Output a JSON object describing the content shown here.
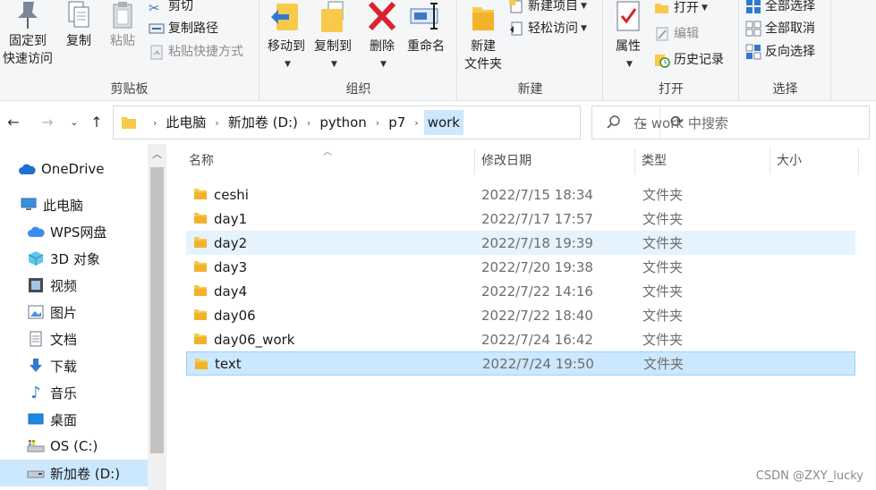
{
  "ribbon": {
    "clipboard": {
      "label": "剪贴板",
      "pin": "固定到\n快速访问",
      "pin_line1": "固定到",
      "pin_line2": "快速访问",
      "copy": "复制",
      "paste": "粘贴",
      "cut": "剪切",
      "copy_path": "复制路径",
      "paste_shortcut": "粘贴快捷方式"
    },
    "organize": {
      "label": "组织",
      "move_to": "移动到",
      "copy_to": "复制到",
      "delete": "删除",
      "rename": "重命名"
    },
    "new": {
      "label": "新建",
      "new_folder_line1": "新建",
      "new_folder_line2": "文件夹",
      "new_item": "新建项目",
      "easy_access": "轻松访问"
    },
    "open": {
      "label": "打开",
      "properties": "属性",
      "open": "打开",
      "edit": "编辑",
      "history": "历史记录"
    },
    "select": {
      "label": "选择",
      "select_all": "全部选择",
      "select_none": "全部取消",
      "invert": "反向选择"
    }
  },
  "address": {
    "crumbs": [
      "此电脑",
      "新加卷 (D:)",
      "python",
      "p7",
      "work"
    ],
    "search_placeholder": "在 work 中搜索"
  },
  "nav": {
    "items": [
      {
        "label": "OneDrive"
      },
      {
        "label": "此电脑"
      },
      {
        "label": "WPS网盘"
      },
      {
        "label": "3D 对象"
      },
      {
        "label": "视频"
      },
      {
        "label": "图片"
      },
      {
        "label": "文档"
      },
      {
        "label": "下载"
      },
      {
        "label": "音乐"
      },
      {
        "label": "桌面"
      },
      {
        "label": "OS (C:)"
      },
      {
        "label": "新加卷 (D:)"
      }
    ]
  },
  "list": {
    "columns": {
      "name": "名称",
      "date": "修改日期",
      "type": "类型",
      "size": "大小"
    },
    "rows": [
      {
        "name": "ceshi",
        "date": "2022/7/15 18:34",
        "type": "文件夹"
      },
      {
        "name": "day1",
        "date": "2022/7/17 17:57",
        "type": "文件夹"
      },
      {
        "name": "day2",
        "date": "2022/7/18 19:39",
        "type": "文件夹"
      },
      {
        "name": "day3",
        "date": "2022/7/20 19:38",
        "type": "文件夹"
      },
      {
        "name": "day4",
        "date": "2022/7/22 14:16",
        "type": "文件夹"
      },
      {
        "name": "day06",
        "date": "2022/7/22 18:40",
        "type": "文件夹"
      },
      {
        "name": "day06_work",
        "date": "2022/7/24 16:42",
        "type": "文件夹"
      },
      {
        "name": "text",
        "date": "2022/7/24 19:50",
        "type": "文件夹"
      }
    ]
  },
  "watermark": "CSDN @ZXY_lucky",
  "colors": {
    "selection": "#cce8ff",
    "hover": "#e5f3ff",
    "folder": "#f8c94a",
    "accent": "#0078d7"
  }
}
